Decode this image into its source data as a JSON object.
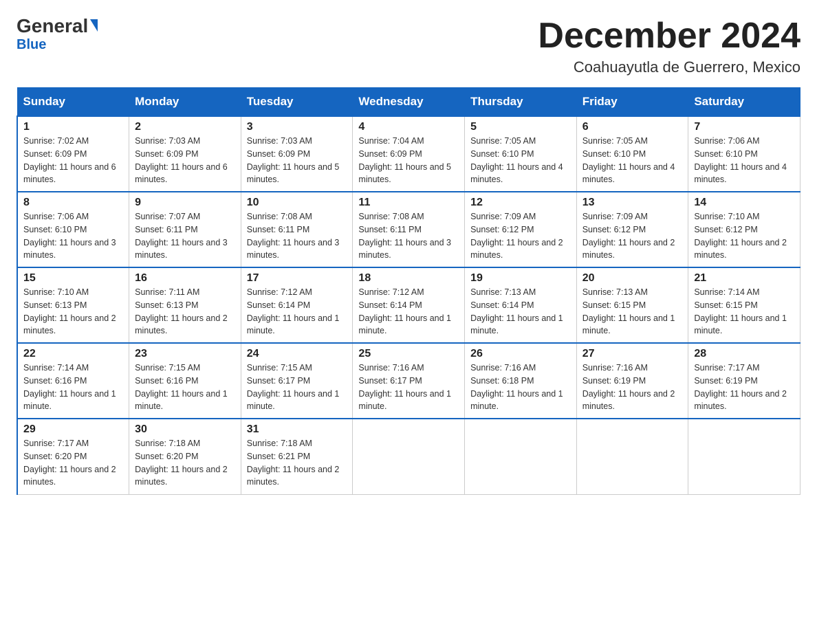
{
  "logo": {
    "general": "General",
    "blue": "Blue",
    "tagline": "Blue"
  },
  "title": "December 2024",
  "location": "Coahuayutla de Guerrero, Mexico",
  "days_of_week": [
    "Sunday",
    "Monday",
    "Tuesday",
    "Wednesday",
    "Thursday",
    "Friday",
    "Saturday"
  ],
  "weeks": [
    [
      {
        "day": "1",
        "sunrise": "7:02 AM",
        "sunset": "6:09 PM",
        "daylight": "11 hours and 6 minutes."
      },
      {
        "day": "2",
        "sunrise": "7:03 AM",
        "sunset": "6:09 PM",
        "daylight": "11 hours and 6 minutes."
      },
      {
        "day": "3",
        "sunrise": "7:03 AM",
        "sunset": "6:09 PM",
        "daylight": "11 hours and 5 minutes."
      },
      {
        "day": "4",
        "sunrise": "7:04 AM",
        "sunset": "6:09 PM",
        "daylight": "11 hours and 5 minutes."
      },
      {
        "day": "5",
        "sunrise": "7:05 AM",
        "sunset": "6:10 PM",
        "daylight": "11 hours and 4 minutes."
      },
      {
        "day": "6",
        "sunrise": "7:05 AM",
        "sunset": "6:10 PM",
        "daylight": "11 hours and 4 minutes."
      },
      {
        "day": "7",
        "sunrise": "7:06 AM",
        "sunset": "6:10 PM",
        "daylight": "11 hours and 4 minutes."
      }
    ],
    [
      {
        "day": "8",
        "sunrise": "7:06 AM",
        "sunset": "6:10 PM",
        "daylight": "11 hours and 3 minutes."
      },
      {
        "day": "9",
        "sunrise": "7:07 AM",
        "sunset": "6:11 PM",
        "daylight": "11 hours and 3 minutes."
      },
      {
        "day": "10",
        "sunrise": "7:08 AM",
        "sunset": "6:11 PM",
        "daylight": "11 hours and 3 minutes."
      },
      {
        "day": "11",
        "sunrise": "7:08 AM",
        "sunset": "6:11 PM",
        "daylight": "11 hours and 3 minutes."
      },
      {
        "day": "12",
        "sunrise": "7:09 AM",
        "sunset": "6:12 PM",
        "daylight": "11 hours and 2 minutes."
      },
      {
        "day": "13",
        "sunrise": "7:09 AM",
        "sunset": "6:12 PM",
        "daylight": "11 hours and 2 minutes."
      },
      {
        "day": "14",
        "sunrise": "7:10 AM",
        "sunset": "6:12 PM",
        "daylight": "11 hours and 2 minutes."
      }
    ],
    [
      {
        "day": "15",
        "sunrise": "7:10 AM",
        "sunset": "6:13 PM",
        "daylight": "11 hours and 2 minutes."
      },
      {
        "day": "16",
        "sunrise": "7:11 AM",
        "sunset": "6:13 PM",
        "daylight": "11 hours and 2 minutes."
      },
      {
        "day": "17",
        "sunrise": "7:12 AM",
        "sunset": "6:14 PM",
        "daylight": "11 hours and 1 minute."
      },
      {
        "day": "18",
        "sunrise": "7:12 AM",
        "sunset": "6:14 PM",
        "daylight": "11 hours and 1 minute."
      },
      {
        "day": "19",
        "sunrise": "7:13 AM",
        "sunset": "6:14 PM",
        "daylight": "11 hours and 1 minute."
      },
      {
        "day": "20",
        "sunrise": "7:13 AM",
        "sunset": "6:15 PM",
        "daylight": "11 hours and 1 minute."
      },
      {
        "day": "21",
        "sunrise": "7:14 AM",
        "sunset": "6:15 PM",
        "daylight": "11 hours and 1 minute."
      }
    ],
    [
      {
        "day": "22",
        "sunrise": "7:14 AM",
        "sunset": "6:16 PM",
        "daylight": "11 hours and 1 minute."
      },
      {
        "day": "23",
        "sunrise": "7:15 AM",
        "sunset": "6:16 PM",
        "daylight": "11 hours and 1 minute."
      },
      {
        "day": "24",
        "sunrise": "7:15 AM",
        "sunset": "6:17 PM",
        "daylight": "11 hours and 1 minute."
      },
      {
        "day": "25",
        "sunrise": "7:16 AM",
        "sunset": "6:17 PM",
        "daylight": "11 hours and 1 minute."
      },
      {
        "day": "26",
        "sunrise": "7:16 AM",
        "sunset": "6:18 PM",
        "daylight": "11 hours and 1 minute."
      },
      {
        "day": "27",
        "sunrise": "7:16 AM",
        "sunset": "6:19 PM",
        "daylight": "11 hours and 2 minutes."
      },
      {
        "day": "28",
        "sunrise": "7:17 AM",
        "sunset": "6:19 PM",
        "daylight": "11 hours and 2 minutes."
      }
    ],
    [
      {
        "day": "29",
        "sunrise": "7:17 AM",
        "sunset": "6:20 PM",
        "daylight": "11 hours and 2 minutes."
      },
      {
        "day": "30",
        "sunrise": "7:18 AM",
        "sunset": "6:20 PM",
        "daylight": "11 hours and 2 minutes."
      },
      {
        "day": "31",
        "sunrise": "7:18 AM",
        "sunset": "6:21 PM",
        "daylight": "11 hours and 2 minutes."
      },
      null,
      null,
      null,
      null
    ]
  ],
  "labels": {
    "sunrise": "Sunrise:",
    "sunset": "Sunset:",
    "daylight": "Daylight:"
  }
}
